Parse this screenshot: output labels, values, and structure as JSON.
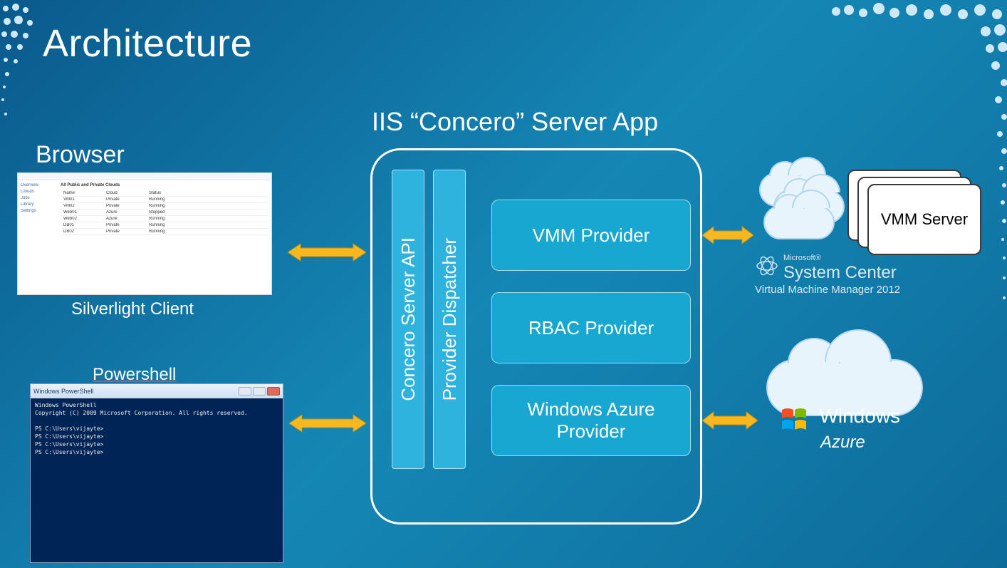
{
  "title": "Architecture",
  "left": {
    "browser_label": "Browser",
    "silverlight_caption": "Silverlight Client",
    "powershell_label": "Powershell",
    "ps_window_title": "Windows PowerShell",
    "ps_lines": "Windows PowerShell\nCopyright (C) 2009 Microsoft Corporation. All rights reserved.\n\nPS C:\\Users\\vijayte>\nPS C:\\Users\\vijayte>\nPS C:\\Users\\vijayte>\nPS C:\\Users\\vijayte>"
  },
  "center": {
    "iis_label": "IIS “Concero” Server App",
    "api_box": "Concero Server API",
    "dispatcher_box": "Provider Dispatcher",
    "providers": {
      "vmm": "VMM Provider",
      "rbac": "RBAC Provider",
      "azure": "Windows Azure Provider"
    }
  },
  "right": {
    "vmm_server": "VMM Server",
    "ms": "Microsoft®",
    "system_center": "System Center",
    "vmm2012": "Virtual Machine Manager 2012",
    "windows": "Windows",
    "azure": "Azure"
  },
  "colors": {
    "box_fill": "#2db3de",
    "provider_fill": "#17a7d0",
    "arrow_fill": "#f7b81f",
    "arrow_stroke": "#bf8f17"
  }
}
